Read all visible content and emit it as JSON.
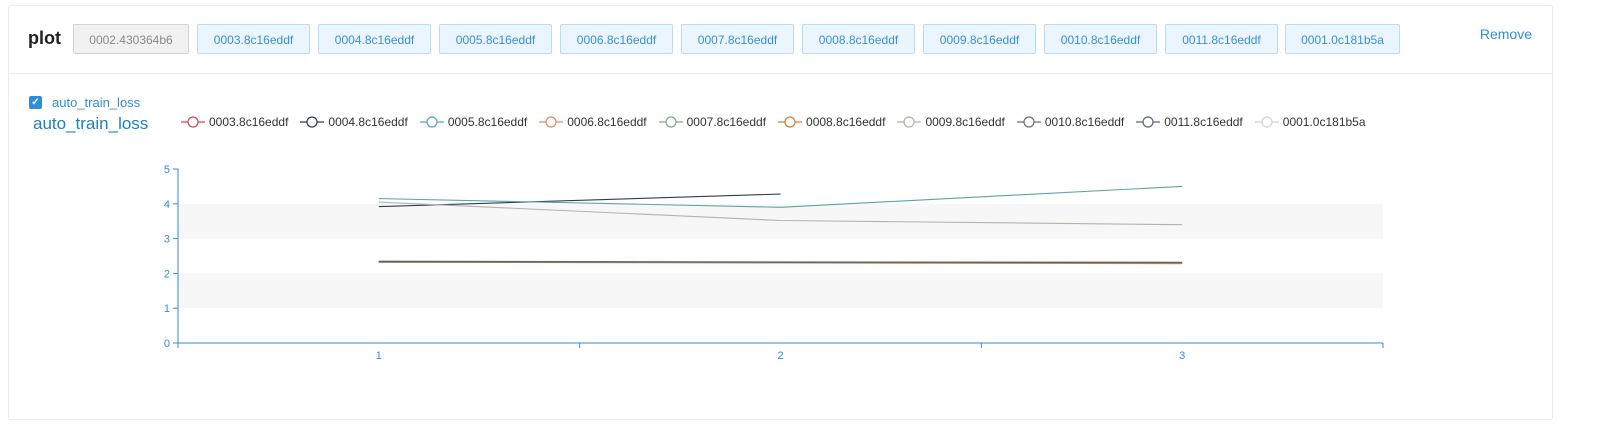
{
  "panel": {
    "title": "plot",
    "remove_label": "Remove",
    "checkbox_label": "auto_train_loss"
  },
  "tags": [
    {
      "label": "0002.430364b6",
      "variant": "muted"
    },
    {
      "label": "0003.8c16eddf",
      "variant": "primary"
    },
    {
      "label": "0004.8c16eddf",
      "variant": "primary"
    },
    {
      "label": "0005.8c16eddf",
      "variant": "primary"
    },
    {
      "label": "0006.8c16eddf",
      "variant": "primary"
    },
    {
      "label": "0007.8c16eddf",
      "variant": "primary"
    },
    {
      "label": "0008.8c16eddf",
      "variant": "primary"
    },
    {
      "label": "0009.8c16eddf",
      "variant": "primary"
    },
    {
      "label": "0010.8c16eddf",
      "variant": "primary"
    },
    {
      "label": "0011.8c16eddf",
      "variant": "primary"
    },
    {
      "label": "0001.0c181b5a",
      "variant": "primary"
    }
  ],
  "colors": {
    "accent": "#2e8fd6",
    "axis": "#2e8fd6",
    "band": "#f7f7f7"
  },
  "chart_data": {
    "type": "line",
    "title": "auto_train_loss",
    "xlabel": "",
    "ylabel": "",
    "x_ticks": [
      "1",
      "2",
      "3"
    ],
    "y_ticks": [
      0,
      1,
      2,
      3,
      4,
      5
    ],
    "ylim": [
      0,
      5
    ],
    "legend_position": "top",
    "grid": "alternating horizontal bands",
    "series": [
      {
        "name": "0003.8c16eddf",
        "color": "#d9484f",
        "x": [
          1,
          2,
          3
        ],
        "values": [
          2.33,
          2.32,
          2.31
        ]
      },
      {
        "name": "0004.8c16eddf",
        "color": "#2f3d53",
        "x": [
          1,
          2
        ],
        "values": [
          3.92,
          4.28
        ]
      },
      {
        "name": "0005.8c16eddf",
        "color": "#5aa6a3",
        "x": [
          1,
          2,
          3
        ],
        "values": [
          4.15,
          3.9,
          4.5
        ]
      },
      {
        "name": "0006.8c16eddf",
        "color": "#de8a6d",
        "x": [
          1,
          2,
          3
        ],
        "values": [
          2.32,
          2.3,
          2.28
        ]
      },
      {
        "name": "0007.8c16eddf",
        "color": "#7fa88c",
        "x": [
          1,
          2,
          3
        ],
        "values": [
          2.32,
          2.31,
          2.3
        ]
      },
      {
        "name": "0008.8c16eddf",
        "color": "#c58533",
        "x": [
          1,
          2,
          3
        ],
        "values": [
          2.33,
          2.31,
          2.29
        ]
      },
      {
        "name": "0009.8c16eddf",
        "color": "#b7b1aa",
        "x": [
          1,
          2,
          3
        ],
        "values": [
          4.05,
          3.52,
          3.4
        ]
      },
      {
        "name": "0010.8c16eddf",
        "color": "#6e6e6e",
        "x": [
          1,
          2,
          3
        ],
        "values": [
          2.35,
          2.33,
          2.32
        ]
      },
      {
        "name": "0011.8c16eddf",
        "color": "#5a6470",
        "x": [
          1,
          2,
          3
        ],
        "values": [
          2.34,
          2.32,
          2.31
        ]
      },
      {
        "name": "0001.0c181b5a",
        "color": "#cfd3d8",
        "x": [],
        "values": []
      }
    ]
  }
}
